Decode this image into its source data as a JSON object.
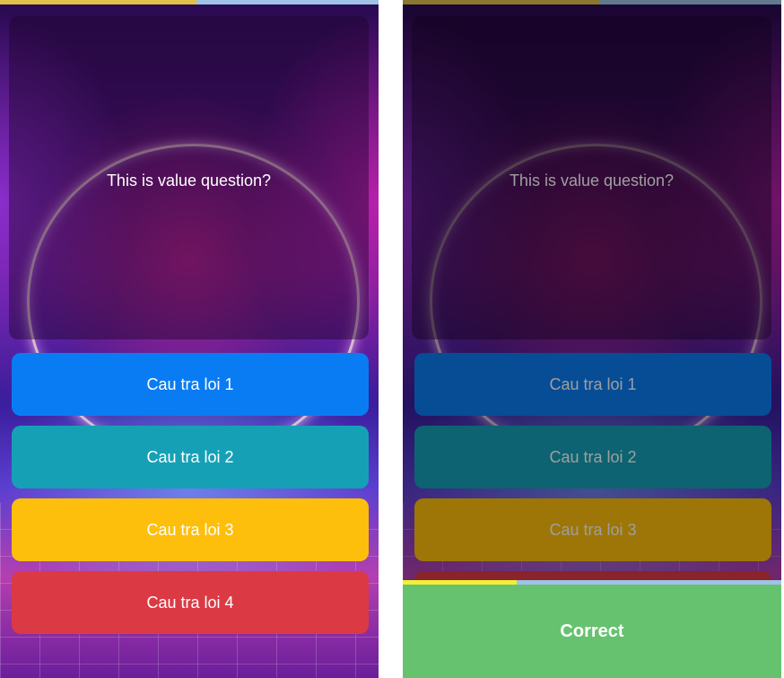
{
  "screens": [
    {
      "question": "This is value question?",
      "progress": 0.52,
      "answers": [
        {
          "label": "Cau tra loi 1",
          "color": "#0a7cf3"
        },
        {
          "label": "Cau tra loi 2",
          "color": "#16a0b6"
        },
        {
          "label": "Cau tra loi 3",
          "color": "#fdbf0c"
        },
        {
          "label": "Cau tra loi 4",
          "color": "#db3a44"
        }
      ]
    },
    {
      "question": "This is value question?",
      "progress": 0.52,
      "answers": [
        {
          "label": "Cau tra loi 1",
          "color": "#0a7cf3"
        },
        {
          "label": "Cau tra loi 2",
          "color": "#16a0b6"
        },
        {
          "label": "Cau tra loi 3",
          "color": "#fdbf0c"
        }
      ],
      "result": {
        "label": "Correct",
        "color": "#66c26f",
        "timer_progress": 0.3
      }
    }
  ]
}
